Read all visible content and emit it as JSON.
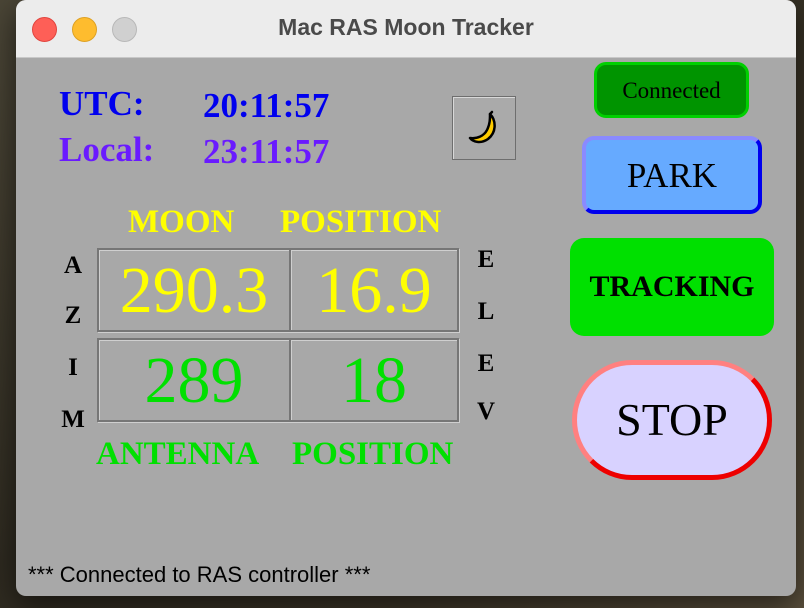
{
  "window": {
    "title": "Mac RAS Moon Tracker"
  },
  "clock": {
    "utc_label": "UTC:",
    "utc_time": "20:11:57",
    "local_label": "Local:",
    "local_time": "23:11:57"
  },
  "moon_button": {
    "icon": "moon-icon"
  },
  "connection": {
    "status": "Connected"
  },
  "controls": {
    "park_label": "PARK",
    "tracking_label": "TRACKING",
    "stop_label": "STOP"
  },
  "moon_position": {
    "title_1": "MOON",
    "title_2": "POSITION",
    "azimuth": "290.3",
    "elevation": "16.9"
  },
  "antenna_position": {
    "title_1": "ANTENNA",
    "title_2": "POSITION",
    "azimuth": "289",
    "elevation": "18"
  },
  "axis_labels": {
    "azim": [
      "A",
      "Z",
      "I",
      "M"
    ],
    "elev": [
      "E",
      "L",
      "E",
      "V"
    ]
  },
  "status_message": "*** Connected to RAS controller ***",
  "colors": {
    "moon": "#ffff00",
    "antenna": "#00e000",
    "utc": "#0000ee",
    "local": "#6a1aff",
    "panel": "#a8a8a8"
  }
}
